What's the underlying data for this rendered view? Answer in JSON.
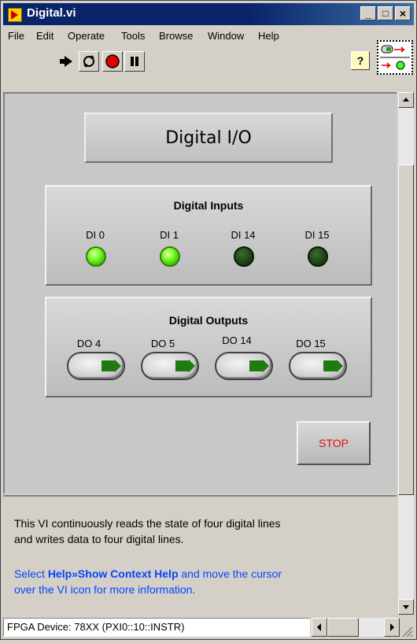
{
  "window": {
    "title": "Digital.vi",
    "controls": [
      "_",
      "□",
      "×"
    ]
  },
  "menubar": {
    "items": [
      "File",
      "Edit",
      "Operate",
      "Tools",
      "Browse",
      "Window",
      "Help"
    ]
  },
  "toolbar": {
    "buttons": [
      "run-arrow-icon",
      "run-continuously-icon",
      "abort-icon",
      "pause-icon"
    ],
    "help_icon": "?"
  },
  "front_panel": {
    "title_label": "Digital I/O",
    "inputs": {
      "title": "Digital Inputs",
      "lines": [
        {
          "label": "DI 0",
          "state": "on"
        },
        {
          "label": "DI 1",
          "state": "on"
        },
        {
          "label": "DI 14",
          "state": "off"
        },
        {
          "label": "DI 15",
          "state": "off"
        }
      ]
    },
    "outputs": {
      "title": "Digital Outputs",
      "lines": [
        {
          "label": "DO 4",
          "state": "off"
        },
        {
          "label": "DO 5",
          "state": "off"
        },
        {
          "label": "DO 14",
          "state": "off"
        },
        {
          "label": "DO 15",
          "state": "off"
        }
      ]
    },
    "stop_label": "STOP"
  },
  "description": {
    "line1": "This VI continuously reads the state of four digital lines",
    "line2": " and writes data to four digital lines.",
    "help_prefix": "Select ",
    "help_bold": "Help»Show Context Help",
    "help_suffix": " and move the cursor",
    "help_line2": "over the VI icon for more information."
  },
  "statusbar": {
    "target": "FPGA Device: 78XX (PXI0::10::INSTR)"
  },
  "colors": {
    "titlebar": "#0a246a",
    "led_on": "#7cff2a",
    "led_off": "#1f4a16",
    "stop_text": "#e01010",
    "help_text": "#0645ff"
  }
}
